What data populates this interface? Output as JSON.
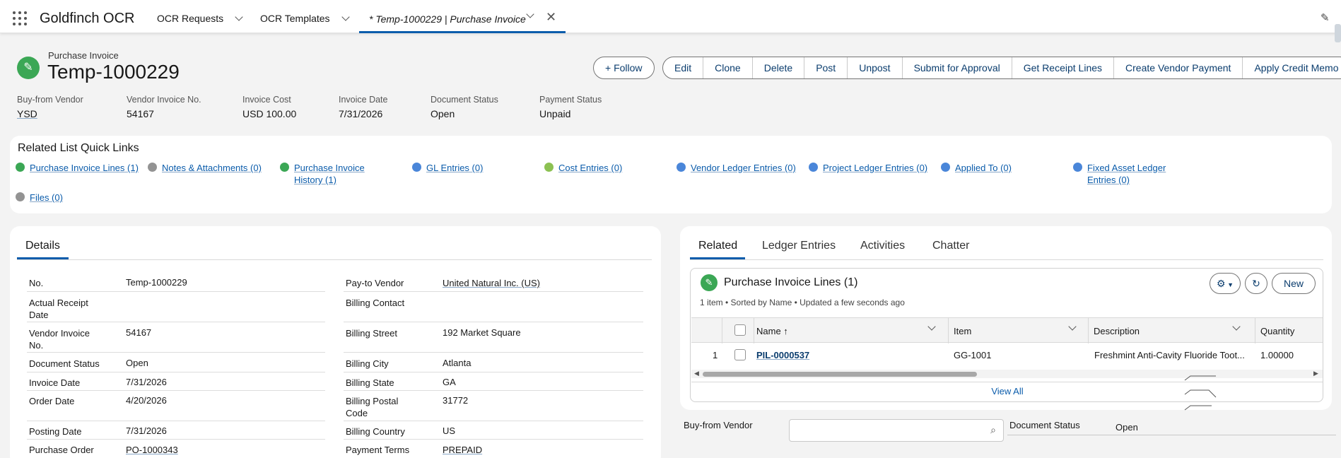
{
  "app": {
    "name": "Goldfinch OCR"
  },
  "nav": {
    "items": [
      "OCR Requests",
      "OCR Templates"
    ],
    "active_tab": "* Temp-1000229 | Purchase Invoice",
    "close": "✕"
  },
  "record": {
    "type": "Purchase Invoice",
    "title": "Temp-1000229",
    "follow": "Follow",
    "actions": [
      "Edit",
      "Clone",
      "Delete",
      "Post",
      "Unpost",
      "Submit for Approval",
      "Get Receipt Lines",
      "Create Vendor Payment",
      "Apply Credit Memo"
    ]
  },
  "highlights": [
    {
      "label": "Buy-from Vendor",
      "value": "YSD"
    },
    {
      "label": "Vendor Invoice No.",
      "value": "54167"
    },
    {
      "label": "Invoice Cost",
      "value": "USD 100.00"
    },
    {
      "label": "Invoice Date",
      "value": "7/31/2026"
    },
    {
      "label": "Document Status",
      "value": "Open"
    },
    {
      "label": "Payment Status",
      "value": "Unpaid"
    }
  ],
  "quick_links": {
    "title": "Related List Quick Links",
    "items": [
      {
        "label": "Purchase Invoice Lines (1)",
        "color": "#3ba755"
      },
      {
        "label": "Notes & Attachments (0)",
        "color": "#939393"
      },
      {
        "label": "Purchase Invoice History (1)",
        "color": "#3ba755"
      },
      {
        "label": "GL Entries (0)",
        "color": "#4a86d9"
      },
      {
        "label": "Cost Entries (0)",
        "color": "#8cc152"
      },
      {
        "label": "Vendor Ledger Entries (0)",
        "color": "#4a86d9"
      },
      {
        "label": "Project Ledger Entries (0)",
        "color": "#4a86d9"
      },
      {
        "label": "Applied To (0)",
        "color": "#4a86d9"
      },
      {
        "label": "Fixed Asset Ledger Entries (0)",
        "color": "#4a86d9"
      },
      {
        "label": "Files (0)",
        "color": "#939393"
      }
    ]
  },
  "details": {
    "tab": "Details",
    "left": [
      {
        "label": "No.",
        "value": "Temp-1000229"
      },
      {
        "label": "Actual Receipt Date",
        "value": ""
      },
      {
        "label": "Vendor Invoice No.",
        "value": "54167"
      },
      {
        "label": "Document Status",
        "value": "Open"
      },
      {
        "label": "Invoice Date",
        "value": "7/31/2026"
      },
      {
        "label": "Order Date",
        "value": "4/20/2026"
      },
      {
        "label": "Posting Date",
        "value": "7/31/2026"
      },
      {
        "label": "Purchase Order",
        "value": "PO-1000343"
      }
    ],
    "right": [
      {
        "label": "Pay-to Vendor",
        "value": "United Natural Inc. (US)"
      },
      {
        "label": "Billing Contact",
        "value": ""
      },
      {
        "label": "Billing Street",
        "value": "192 Market Square"
      },
      {
        "label": "Billing City",
        "value": "Atlanta"
      },
      {
        "label": "Billing State",
        "value": "GA"
      },
      {
        "label": "Billing Postal Code",
        "value": "31772"
      },
      {
        "label": "Billing Country",
        "value": "US"
      },
      {
        "label": "Payment Terms",
        "value": "PREPAID"
      }
    ]
  },
  "related": {
    "tabs": [
      "Related",
      "Ledger Entries",
      "Activities",
      "Chatter"
    ],
    "list_title": "Purchase Invoice Lines (1)",
    "list_sub": "1 item • Sorted by Name • Updated a few seconds ago",
    "new_button": "New",
    "columns": [
      "Name ↑",
      "Item",
      "Description",
      "Quantity"
    ],
    "rows": [
      {
        "num": "1",
        "name": "PIL-0000537",
        "item": "GG-1001",
        "description": "Freshmint Anti-Cavity Fluoride Toot...",
        "quantity": "1.00000"
      }
    ],
    "view_all": "View All"
  },
  "bottom": {
    "vendor_label": "Buy-from Vendor",
    "status_label": "Document Status",
    "status_value": "Open"
  }
}
